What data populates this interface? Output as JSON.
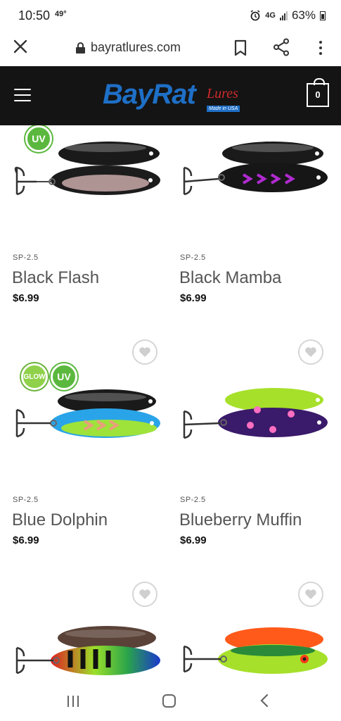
{
  "status_bar": {
    "time": "10:50",
    "temperature": "49°",
    "network": "4G",
    "battery": "63%"
  },
  "browser": {
    "url": "bayratlures.com",
    "icons": [
      "close-icon",
      "lock-icon",
      "bookmark-icon",
      "share-icon",
      "more-vert-icon"
    ]
  },
  "site_header": {
    "logo_brand": "BayRat",
    "logo_suffix": "Lures",
    "logo_tagline": "Made in USA",
    "cart_count": "0"
  },
  "products": [
    {
      "sku": "SP-2.5",
      "name": "Black Flash",
      "price": "$6.99",
      "badges": [
        "UV"
      ],
      "favorite": false
    },
    {
      "sku": "SP-2.5",
      "name": "Black Mamba",
      "price": "$6.99",
      "badges": [],
      "favorite": false
    },
    {
      "sku": "SP-2.5",
      "name": "Blue Dolphin",
      "price": "$6.99",
      "badges": [
        "GLOW",
        "UV"
      ],
      "favorite": true
    },
    {
      "sku": "SP-2.5",
      "name": "Blueberry Muffin",
      "price": "$6.99",
      "badges": [],
      "favorite": true
    },
    {
      "sku": "",
      "name": "",
      "price": "",
      "badges": [],
      "favorite": true
    },
    {
      "sku": "",
      "name": "",
      "price": "",
      "badges": [],
      "favorite": true
    }
  ],
  "colors": {
    "header_bg": "#141414",
    "brand_blue": "#1e6fc6",
    "brand_red": "#d02a2a",
    "badge_green": "#5bb83e"
  }
}
